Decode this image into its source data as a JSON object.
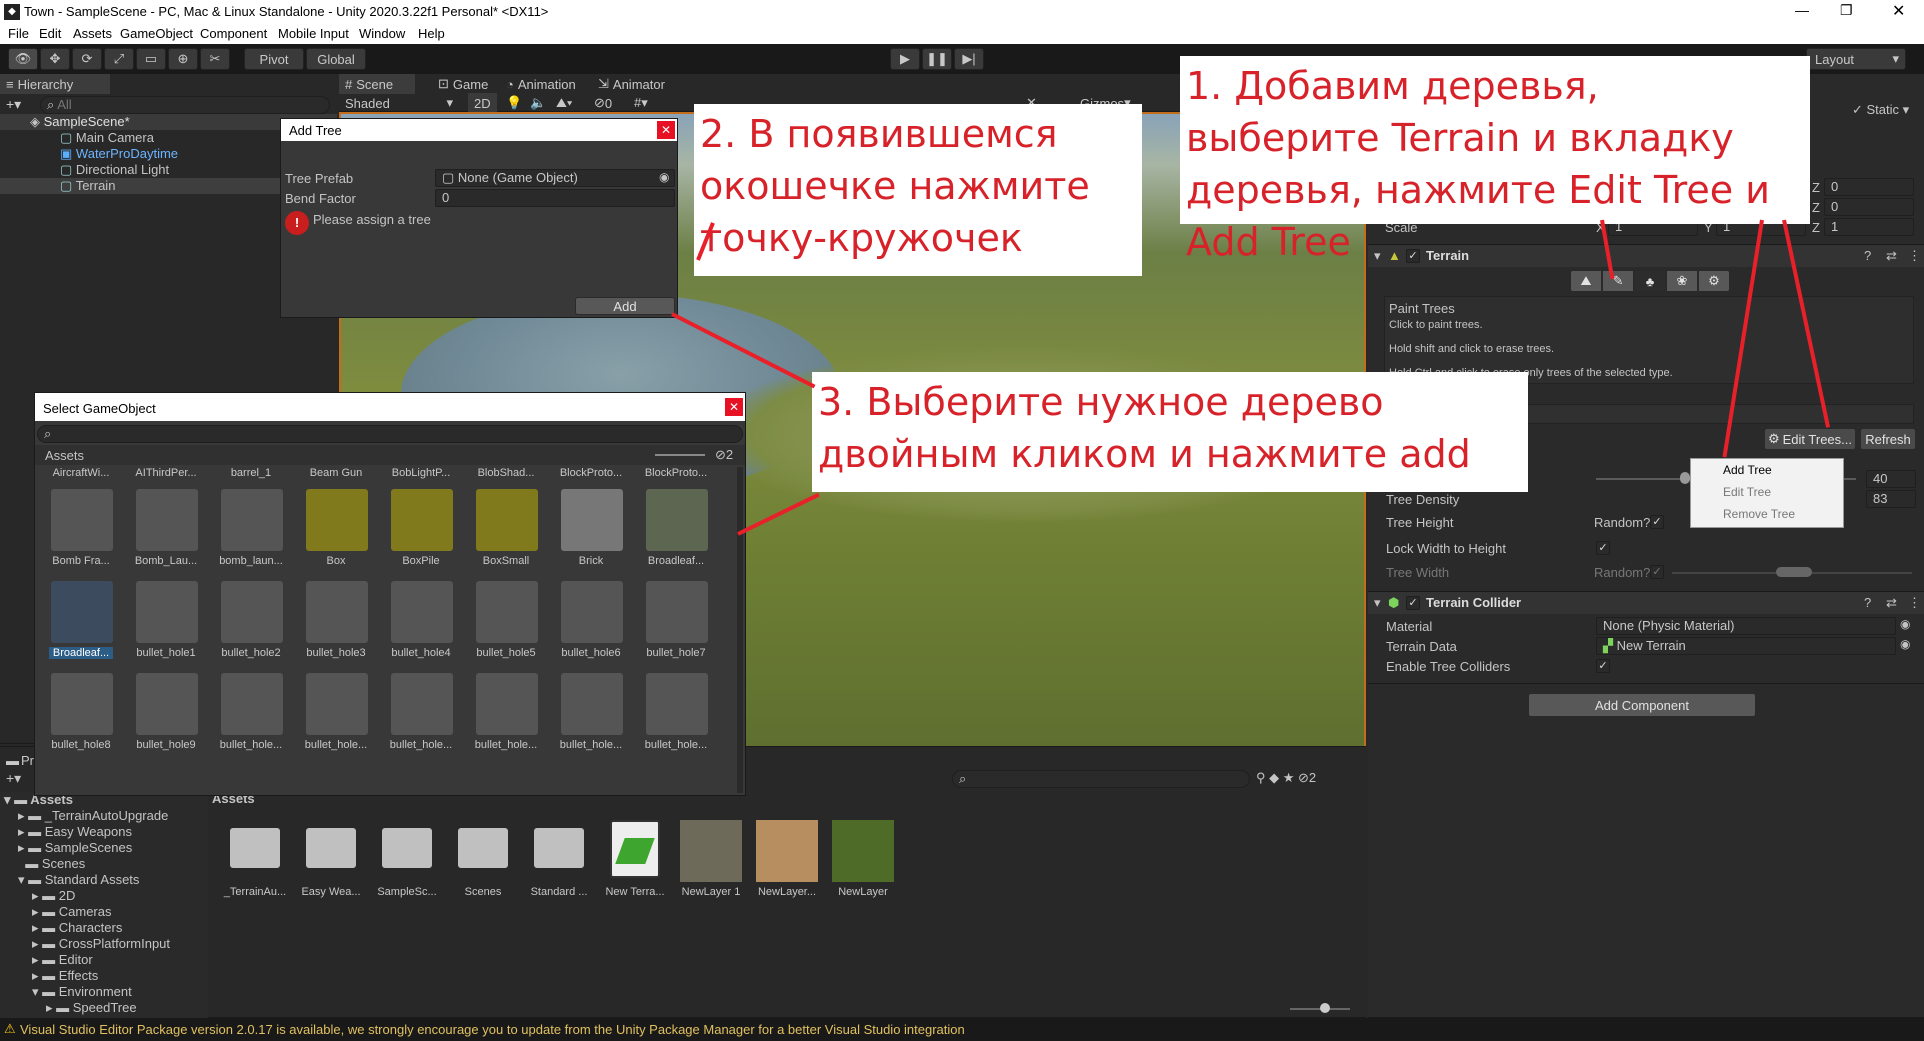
{
  "window": {
    "title": "Town - SampleScene - PC, Mac & Linux Standalone - Unity 2020.3.22f1 Personal* <DX11>"
  },
  "menu": [
    "File",
    "Edit",
    "Assets",
    "GameObject",
    "Component",
    "Mobile Input",
    "Window",
    "Help"
  ],
  "toolbar": {
    "pivot": "Pivot",
    "global": "Global",
    "layout": "Layout"
  },
  "hierarchy": {
    "tab": "Hierarchy",
    "search_placeholder": "All",
    "scene": "SampleScene*",
    "items": [
      "Main Camera",
      "WaterProDaytime",
      "Directional Light",
      "Terrain"
    ]
  },
  "scene_tabs": {
    "scene": "Scene",
    "game": "Game",
    "animation": "Animation",
    "animator": "Animator",
    "shading": "Shaded",
    "mode2d": "2D",
    "gizmos": "Gizmos",
    "hidden_count": "0"
  },
  "add_tree": {
    "title": "Add Tree",
    "prefab_label": "Tree Prefab",
    "prefab_value": "None (Game Object)",
    "bend_label": "Bend Factor",
    "bend_value": "0",
    "warning": "Please assign a tree",
    "add_button": "Add"
  },
  "select_go": {
    "title": "Select GameObject",
    "tab": "Assets",
    "hidden_count": "2",
    "header_row": [
      "AircraftWi...",
      "AIThirdPer...",
      "barrel_1",
      "Beam Gun",
      "BobLightP...",
      "BlobShad...",
      "BlockProto...",
      "BlockProto..."
    ],
    "row1": [
      "Bomb Fra...",
      "Bomb_Lau...",
      "bomb_laun...",
      "Box",
      "BoxPile",
      "BoxSmall",
      "Brick",
      "Broadleaf..."
    ],
    "row2": [
      "Broadleaf...",
      "bullet_hole1",
      "bullet_hole2",
      "bullet_hole3",
      "bullet_hole4",
      "bullet_hole5",
      "bullet_hole6",
      "bullet_hole7"
    ],
    "row3": [
      "bullet_hole8",
      "bullet_hole9",
      "bullet_hole...",
      "bullet_hole...",
      "bullet_hole...",
      "bullet_hole...",
      "bullet_hole...",
      "bullet_hole..."
    ]
  },
  "project": {
    "tab": "Pr",
    "root": "Assets",
    "tree": [
      "_TerrainAutoUpgrade",
      "Easy Weapons",
      "SampleScenes",
      "Scenes",
      "Standard Assets",
      "2D",
      "Cameras",
      "Characters",
      "CrossPlatformInput",
      "Editor",
      "Effects",
      "Environment",
      "SpeedTree"
    ],
    "breadcrumb": "Assets",
    "hidden_count": "2",
    "assets": [
      "_TerrainAu...",
      "Easy Wea...",
      "SampleSc...",
      "Scenes",
      "Standard ...",
      "New Terra...",
      "NewLayer 1",
      "NewLayer...",
      "NewLayer"
    ]
  },
  "inspector": {
    "static_label": "Static",
    "scale_label": "Scale",
    "xyz": [
      "X",
      "Y",
      "Z"
    ],
    "pos_z": "0",
    "rot_z": "0",
    "scale_x": "1",
    "scale_y": "1",
    "scale_z": "1",
    "terrain_title": "Terrain",
    "paint_title": "Paint Trees",
    "paint_lines": [
      "Click to paint trees.",
      "Hold shift and click to erase trees.",
      "Hold Ctrl and click to erase only trees of the selected type."
    ],
    "edit_trees": "Edit Trees...",
    "refresh": "Refresh",
    "menu_items": [
      "Add Tree",
      "Edit Tree",
      "Remove Tree"
    ],
    "brush_size": "40",
    "density": "83",
    "tree_density": "Tree Density",
    "tree_height": "Tree Height",
    "random": "Random?",
    "lock_width": "Lock Width to Height",
    "tree_width": "Tree Width",
    "collider_title": "Terrain Collider",
    "material_label": "Material",
    "material_value": "None (Physic Material)",
    "terrain_data_label": "Terrain Data",
    "terrain_data_value": "New Terrain",
    "enable_colliders": "Enable Tree Colliders",
    "add_component": "Add Component"
  },
  "status": "Visual Studio Editor Package version 2.0.17 is available, we strongly encourage you to update from the Unity Package Manager for a better Visual Studio integration",
  "callouts": {
    "one": "1. Добавим деревья, выберите Terrain и вкладку деревья, нажмите Edit Tree и Add Tree",
    "two": "2. В появившемся окошечке нажмите точку-кружочек",
    "three": "3. Выберите нужное дерево двойным кликом и нажмите add"
  },
  "colors": {
    "accent_orange": "#c46d1b",
    "callout_red": "#d8222a",
    "selection_blue": "#2c5d87",
    "warning_red": "#e81123"
  }
}
